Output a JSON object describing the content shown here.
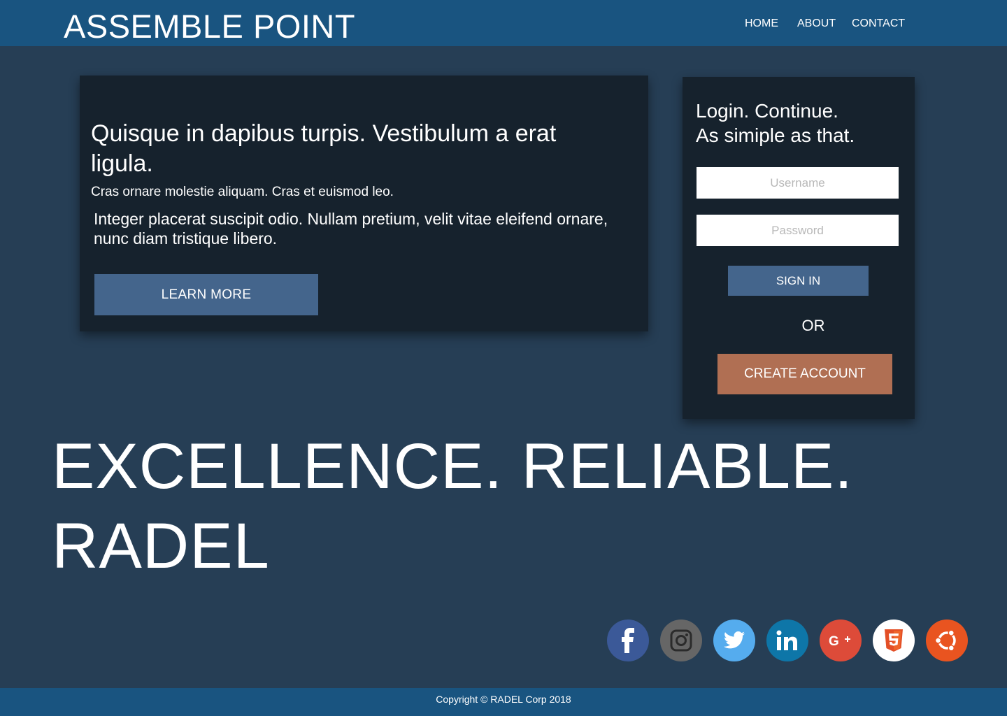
{
  "header": {
    "brand": "ASSEMBLE POINT",
    "nav": {
      "home": "HOME",
      "about": "ABOUT",
      "contact": "CONTACT"
    }
  },
  "hero": {
    "heading": "Quisque in dapibus turpis. Vestibulum a erat ligula.",
    "subheading": "Cras ornare molestie aliquam. Cras et euismod leo.",
    "body": "Integer placerat suscipit odio. Nullam pretium, velit vitae eleifend ornare, nunc diam tristique libero.",
    "button": "LEARN MORE"
  },
  "login": {
    "title_line1": "Login. Continue.",
    "title_line2": "As simiple as that.",
    "username_placeholder": "Username",
    "password_placeholder": "Password",
    "signin": "SIGN IN",
    "or": "OR",
    "create": "CREATE ACCOUNT"
  },
  "tagline": {
    "line1": "EXCELLENCE. RELIABLE.",
    "line2": "RADEL"
  },
  "socials": [
    {
      "name": "facebook-icon",
      "color": "#3b5998"
    },
    {
      "name": "instagram-icon",
      "color": "#666666"
    },
    {
      "name": "twitter-icon",
      "color": "#55acee"
    },
    {
      "name": "linkedin-icon",
      "color": "#0e76a8"
    },
    {
      "name": "google-plus-icon",
      "color": "#dd4b39"
    },
    {
      "name": "html5-icon",
      "color": "#ffffff"
    },
    {
      "name": "ubuntu-icon",
      "color": "#e95420"
    }
  ],
  "footer": {
    "copyright": "Copyright  © RADEL Corp 2018"
  },
  "colors": {
    "background": "#263e55",
    "header": "#195480",
    "card": "#16222d",
    "primary_button": "#44658c",
    "create_button": "#b06f53"
  }
}
